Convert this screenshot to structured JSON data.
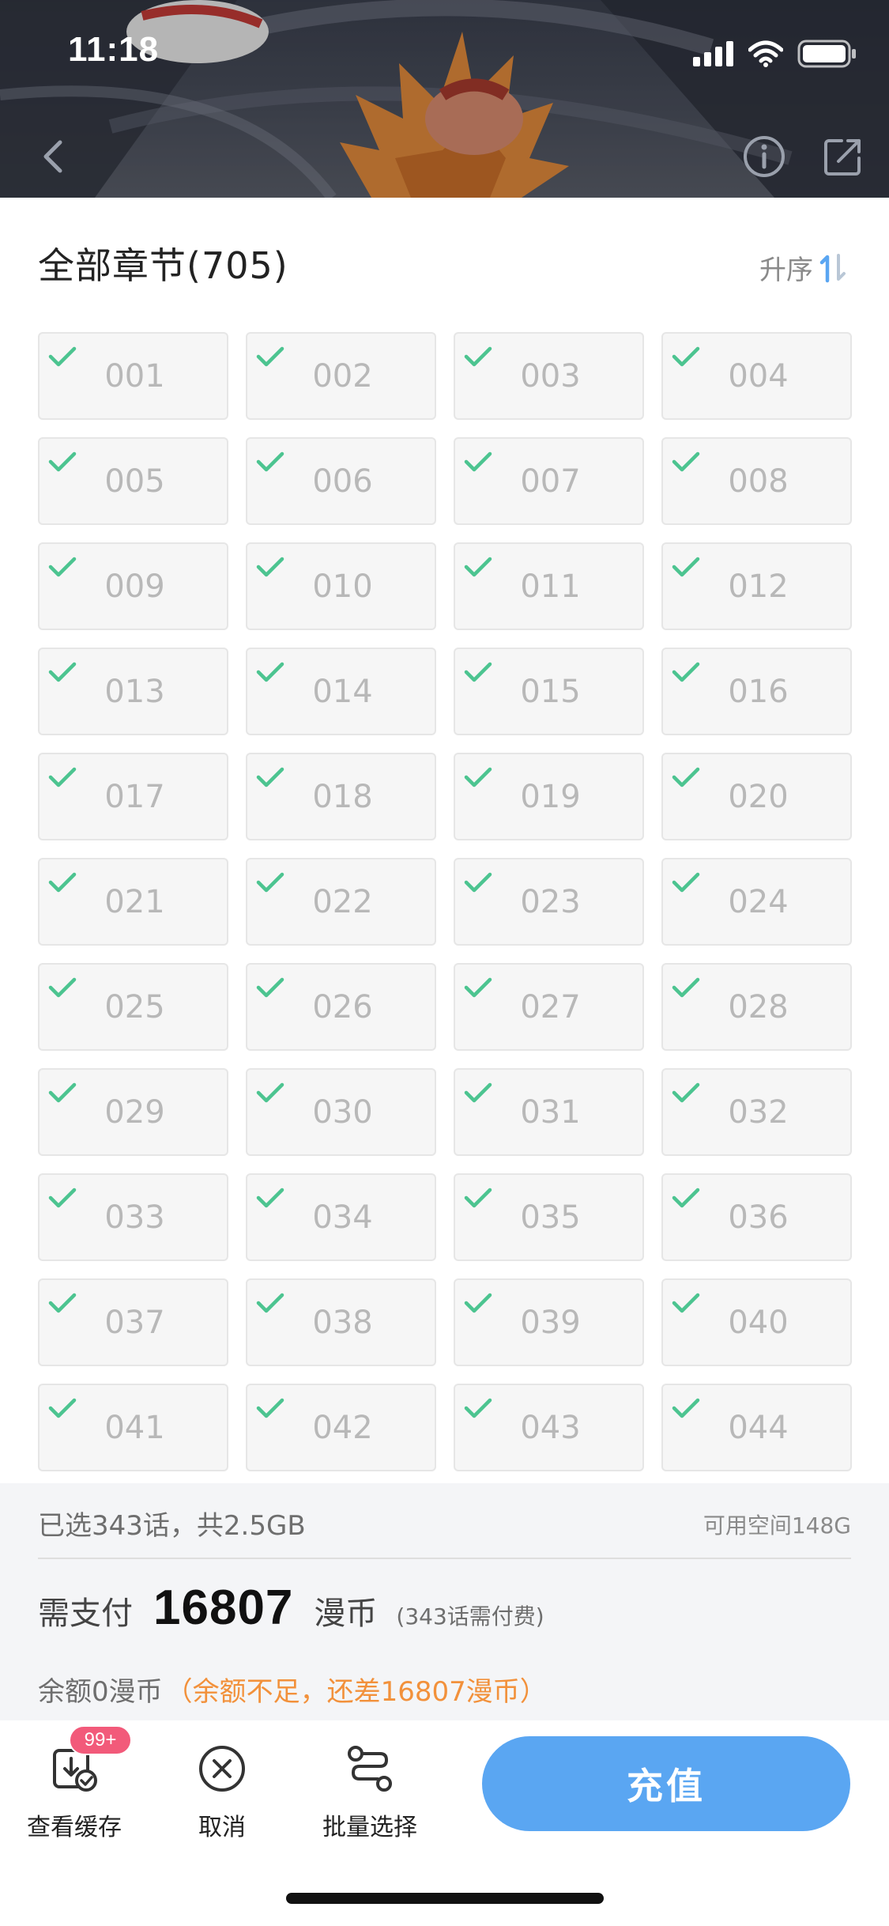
{
  "status_bar": {
    "time": "11:18",
    "icons": [
      "signal-icon",
      "wifi-icon",
      "battery-icon"
    ]
  },
  "header": {
    "icons": [
      "back-icon",
      "info-icon",
      "share-icon"
    ]
  },
  "chapters": {
    "title": "全部章节(705)",
    "sort_label": "升序",
    "sort_icon": "sort-arrows-icon",
    "check_color": "#4cc490",
    "items": [
      {
        "label": "001",
        "checked": true
      },
      {
        "label": "002",
        "checked": true
      },
      {
        "label": "003",
        "checked": true
      },
      {
        "label": "004",
        "checked": true
      },
      {
        "label": "005",
        "checked": true
      },
      {
        "label": "006",
        "checked": true
      },
      {
        "label": "007",
        "checked": true
      },
      {
        "label": "008",
        "checked": true
      },
      {
        "label": "009",
        "checked": true
      },
      {
        "label": "010",
        "checked": true
      },
      {
        "label": "011",
        "checked": true
      },
      {
        "label": "012",
        "checked": true
      },
      {
        "label": "013",
        "checked": true
      },
      {
        "label": "014",
        "checked": true
      },
      {
        "label": "015",
        "checked": true
      },
      {
        "label": "016",
        "checked": true
      },
      {
        "label": "017",
        "checked": true
      },
      {
        "label": "018",
        "checked": true
      },
      {
        "label": "019",
        "checked": true
      },
      {
        "label": "020",
        "checked": true
      },
      {
        "label": "021",
        "checked": true
      },
      {
        "label": "022",
        "checked": true
      },
      {
        "label": "023",
        "checked": true
      },
      {
        "label": "024",
        "checked": true
      },
      {
        "label": "025",
        "checked": true
      },
      {
        "label": "026",
        "checked": true
      },
      {
        "label": "027",
        "checked": true
      },
      {
        "label": "028",
        "checked": true
      },
      {
        "label": "029",
        "checked": true
      },
      {
        "label": "030",
        "checked": true
      },
      {
        "label": "031",
        "checked": true
      },
      {
        "label": "032",
        "checked": true
      },
      {
        "label": "033",
        "checked": true
      },
      {
        "label": "034",
        "checked": true
      },
      {
        "label": "035",
        "checked": true
      },
      {
        "label": "036",
        "checked": true
      },
      {
        "label": "037",
        "checked": true
      },
      {
        "label": "038",
        "checked": true
      },
      {
        "label": "039",
        "checked": true
      },
      {
        "label": "040",
        "checked": true
      },
      {
        "label": "041",
        "checked": true
      },
      {
        "label": "042",
        "checked": true
      },
      {
        "label": "043",
        "checked": true
      },
      {
        "label": "044",
        "checked": true
      }
    ]
  },
  "summary": {
    "selected_info": "已选343话，共2.5GB",
    "space_info": "可用空间148G",
    "pay_label": "需支付",
    "pay_amount": "16807",
    "pay_unit": "漫币",
    "pay_note": "(343话需付费)",
    "balance_text": "余额0漫币",
    "balance_warning": "（余额不足，还差16807漫币）",
    "warning_color": "#f2913b"
  },
  "toolbar": {
    "view_cache_label": "查看缓存",
    "view_cache_badge": "99+",
    "cancel_label": "取消",
    "batch_select_label": "批量选择",
    "recharge_label": "充值",
    "accent_color": "#5aa6f2"
  }
}
